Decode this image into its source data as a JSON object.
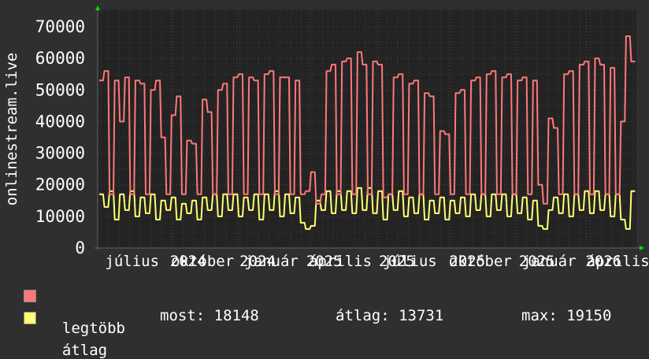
{
  "chart_data": {
    "type": "line",
    "ylabel": "onlinestream.live",
    "ylim": [
      0,
      75000
    ],
    "yticks": [
      0,
      10000,
      20000,
      30000,
      40000,
      50000,
      60000,
      70000
    ],
    "xrange": [
      "2024-06-05",
      "2026-05-10"
    ],
    "grid": true,
    "month_labels": [
      {
        "date": "2024-07-20",
        "label": "július"
      },
      {
        "date": "2024-10-20",
        "label": "október"
      },
      {
        "date": "2025-01-18",
        "label": "január"
      },
      {
        "date": "2025-04-18",
        "label": "április"
      },
      {
        "date": "2025-07-18",
        "label": "július"
      },
      {
        "date": "2025-10-18",
        "label": "október"
      },
      {
        "date": "2026-01-16",
        "label": "január"
      },
      {
        "date": "2026-04-16",
        "label": "április"
      }
    ],
    "year_labels": [
      {
        "date": "2024-10-01",
        "label": "2024"
      },
      {
        "date": "2024-12-31",
        "label": "2024"
      },
      {
        "date": "2025-03-28",
        "label": "2025"
      },
      {
        "date": "2025-07-01",
        "label": "2025"
      },
      {
        "date": "2025-10-01",
        "label": "2025"
      },
      {
        "date": "2025-12-31",
        "label": "2025"
      },
      {
        "date": "2026-03-28",
        "label": "2026"
      }
    ],
    "series": [
      {
        "name": "legtöbb",
        "color": "#ff7878",
        "values": [
          53000,
          56000,
          17000,
          53000,
          40000,
          54000,
          17000,
          53000,
          52000,
          17000,
          50000,
          53000,
          35000,
          17000,
          42000,
          48000,
          17000,
          34000,
          33000,
          17000,
          47000,
          43000,
          17000,
          50000,
          52000,
          17000,
          54000,
          55000,
          17000,
          54000,
          53000,
          17000,
          55000,
          56000,
          17000,
          54000,
          54000,
          17000,
          53000,
          17000,
          18000,
          24000,
          14000,
          17000,
          56000,
          58000,
          17000,
          59000,
          60000,
          17000,
          62000,
          58000,
          17000,
          59000,
          58000,
          16000,
          17000,
          54000,
          55000,
          17000,
          52000,
          53000,
          17000,
          49000,
          48000,
          17000,
          37000,
          36000,
          17000,
          49000,
          50000,
          17000,
          53000,
          54000,
          17000,
          55000,
          56000,
          17000,
          54000,
          55000,
          17000,
          53000,
          54000,
          17000,
          53000,
          20000,
          14000,
          41000,
          38000,
          17000,
          55000,
          56000,
          17000,
          58000,
          59000,
          17000,
          60000,
          58000,
          17000,
          57000,
          17000,
          40000,
          67000,
          59000
        ]
      },
      {
        "name": "átlag",
        "color": "#ffff70",
        "values": [
          17000,
          13000,
          18000,
          9000,
          17000,
          12000,
          18000,
          10000,
          16000,
          11000,
          17000,
          9000,
          15000,
          12000,
          16000,
          9000,
          14000,
          11000,
          15000,
          9000,
          16000,
          12000,
          17000,
          10000,
          17000,
          12000,
          17000,
          10000,
          16000,
          12000,
          17000,
          9000,
          17000,
          12000,
          18000,
          10000,
          17000,
          11000,
          16000,
          8000,
          6000,
          7000,
          15000,
          12000,
          18000,
          11000,
          18000,
          12000,
          18000,
          11000,
          19000,
          12000,
          19000,
          11000,
          18000,
          9000,
          17000,
          12000,
          18000,
          10000,
          16000,
          11000,
          17000,
          9000,
          15000,
          11000,
          16000,
          9000,
          15000,
          11000,
          16000,
          10000,
          17000,
          12000,
          17000,
          10000,
          17000,
          12000,
          17000,
          10000,
          17000,
          11000,
          16000,
          9000,
          15000,
          7000,
          6000,
          12000,
          16000,
          11000,
          17000,
          10000,
          17000,
          12000,
          18000,
          11000,
          18000,
          12000,
          17000,
          10000,
          17000,
          9000,
          6000,
          18000
        ]
      }
    ]
  },
  "legend": {
    "items": [
      {
        "label": "legtöbb",
        "color": "#ff7878"
      },
      {
        "label": "átlag",
        "color": "#ffff70"
      }
    ],
    "stats": {
      "current": "most: 18148",
      "average": "átlag: 13731",
      "max": "max: 19150"
    }
  }
}
